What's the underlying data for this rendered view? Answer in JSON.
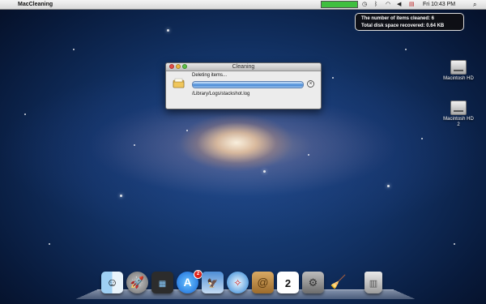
{
  "menubar": {
    "app_name": "MacCleaning",
    "clock": "Fri 10:43 PM",
    "status_level": 1.0
  },
  "hud": {
    "items_cleaned": "The number of items cleaned: 6",
    "space_recovered": "Total disk space recovered: 0.64 KB"
  },
  "window": {
    "title": "Cleaning",
    "status": "Deleting items...",
    "path": "/Library/Logs/stackshot.log",
    "progress": 1.0,
    "stop_symbol": "×"
  },
  "desktop_icons": [
    {
      "label": "Macintosh HD"
    },
    {
      "label": "Macintosh HD 2"
    }
  ],
  "dock": {
    "appstore_badge": "2",
    "calendar_day": "2",
    "items": [
      "finder-icon",
      "launchpad-icon",
      "mission-control-icon",
      "app-store-icon",
      "preview-icon",
      "safari-icon",
      "address-book-icon",
      "ical-icon",
      "system-preferences-icon",
      "maccleaning-icon",
      "trash-icon"
    ]
  }
}
